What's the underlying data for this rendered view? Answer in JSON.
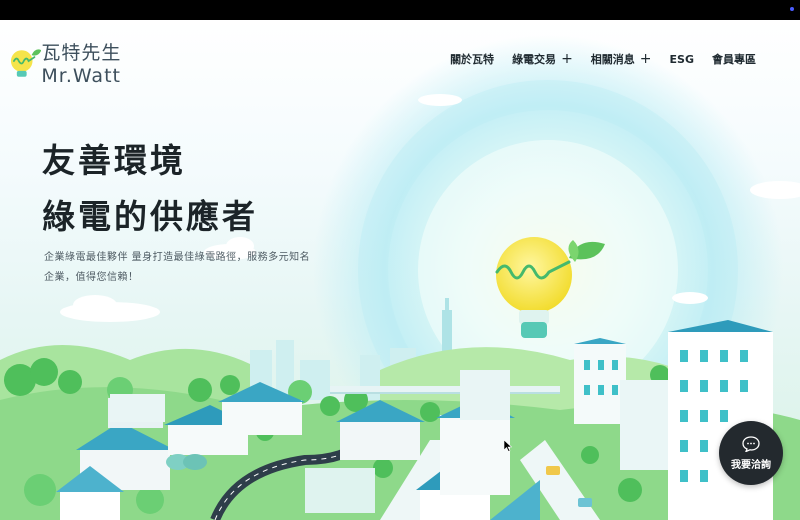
{
  "brand": {
    "name": "瓦特先生Mr.Watt"
  },
  "nav": [
    {
      "label": "關於瓦特",
      "has_submenu": false
    },
    {
      "label": "綠電交易",
      "has_submenu": true
    },
    {
      "label": "相關消息",
      "has_submenu": true
    },
    {
      "label": "ESG",
      "has_submenu": false
    },
    {
      "label": "會員專區",
      "has_submenu": false
    }
  ],
  "hero": {
    "headline_line1": "友善環境",
    "headline_line2": "綠電的供應者",
    "subtext": "企業綠電最佳夥伴 量身打造最佳綠電路徑，服務多元知名企業，值得您信賴！"
  },
  "chat": {
    "label": "我要洽詢",
    "icon": "speech-bubble-icon"
  },
  "colors": {
    "accent_green": "#5cc25b",
    "bulb_yellow": "#f5e44a",
    "sky_glow": "#c8f0f6",
    "chat_bg": "#23292e"
  }
}
